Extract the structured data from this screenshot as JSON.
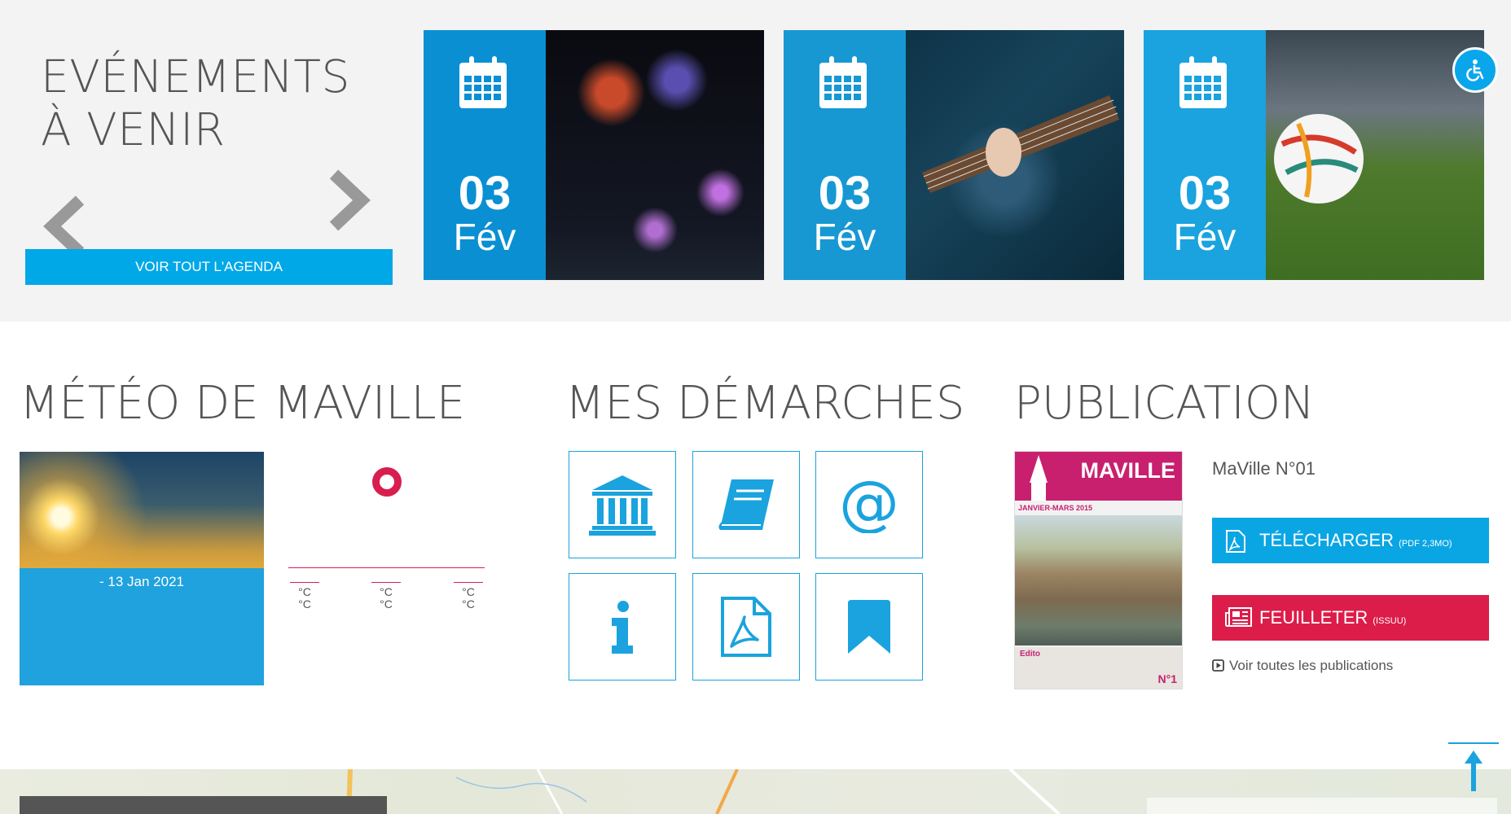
{
  "events": {
    "title": "EVÉNEMENTS À VENIR",
    "agenda_button": "VOIR TOUT L'AGENDA",
    "cards": [
      {
        "day": "03",
        "month": "Fév",
        "photo_icon": "fireworks"
      },
      {
        "day": "03",
        "month": "Fév",
        "photo_icon": "guitar"
      },
      {
        "day": "03",
        "month": "Fév",
        "photo_icon": "football"
      }
    ]
  },
  "accessibility": {
    "icon": "wheelchair-icon"
  },
  "meteo": {
    "title": "MÉTÉO DE MAVILLE",
    "date": "- 13 Jan 2021",
    "temps": [
      {
        "max": "°C",
        "min": "°C"
      },
      {
        "max": "°C",
        "min": "°C"
      },
      {
        "max": "°C",
        "min": "°C"
      }
    ]
  },
  "demarches": {
    "title": "MES DÉMARCHES",
    "tiles": [
      "bank-icon",
      "book-icon",
      "at-icon",
      "info-icon",
      "pdf-icon",
      "bookmark-icon"
    ]
  },
  "publication": {
    "title": "PUBLICATION",
    "name": "MaVille N°01",
    "cover": {
      "logo": "MAVILLE",
      "period": "JANVIER-MARS 2015",
      "edito": "Edito",
      "number": "N°1"
    },
    "download_label": "TÉLÉCHARGER",
    "download_meta": "(PDF 2,3MO)",
    "feuilleter_label": "FEUILLETER",
    "feuilleter_meta": "(ISSUU)",
    "all_link": "Voir toutes les publications"
  },
  "colors": {
    "accent_blue": "#00a8e8",
    "accent_red": "#dc1d49",
    "publication_pink": "#c8206f"
  }
}
